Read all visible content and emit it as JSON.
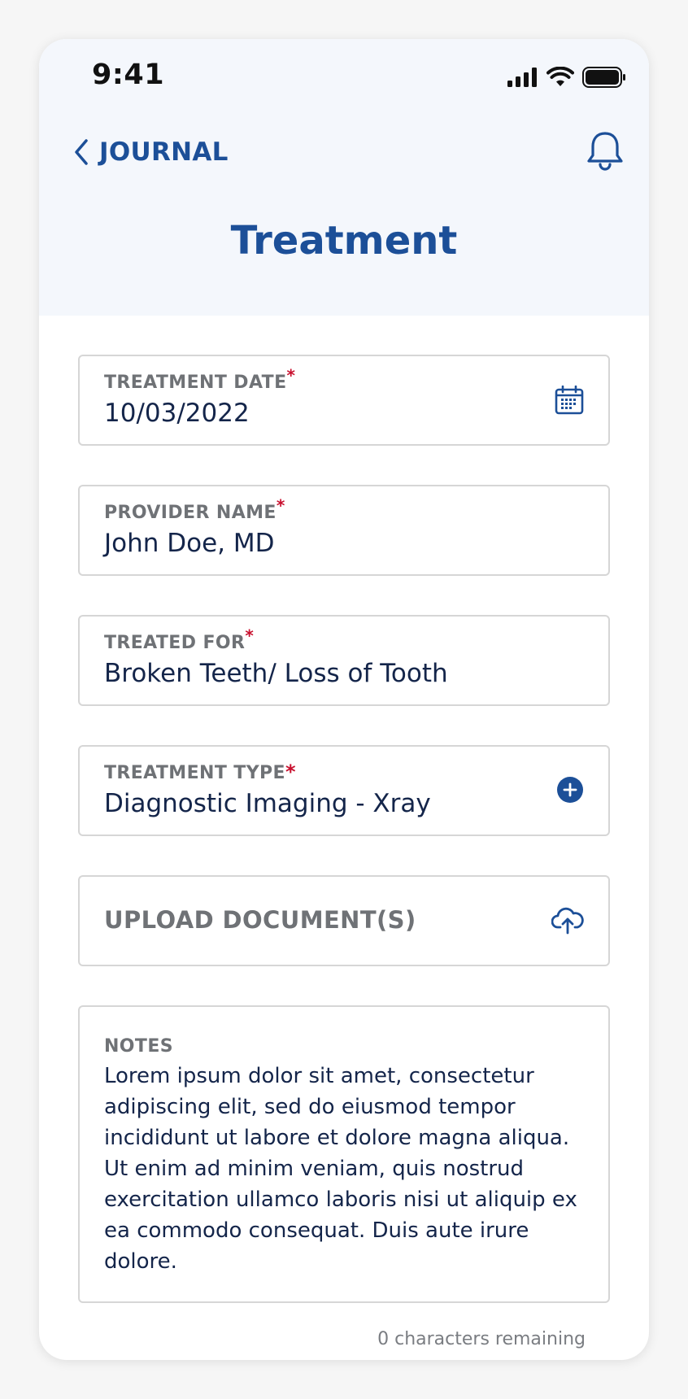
{
  "status_bar": {
    "time": "9:41"
  },
  "nav": {
    "back_label": "JOURNAL"
  },
  "page": {
    "title": "Treatment"
  },
  "form": {
    "treatment_date": {
      "label": "TREATMENT DATE",
      "required": "*",
      "value": "10/03/2022",
      "icon": "calendar-icon"
    },
    "provider_name": {
      "label": "PROVIDER NAME",
      "required": "*",
      "value": "John Doe, MD"
    },
    "treated_for": {
      "label": "TREATED FOR",
      "required": "*",
      "value": "Broken Teeth/ Loss of Tooth"
    },
    "treatment_type": {
      "label": "TREATMENT TYPE",
      "required": "*",
      "value": "Diagnostic Imaging - Xray",
      "icon": "plus-circle-icon"
    },
    "upload": {
      "label": "UPLOAD DOCUMENT(S)",
      "icon": "cloud-upload-icon"
    },
    "notes": {
      "label": "NOTES",
      "value": "Lorem ipsum dolor sit amet, consectetur adipiscing elit, sed do eiusmod tempor incididunt ut labore et dolore magna aliqua. Ut enim ad minim veniam, quis nostrud exercitation ullamco laboris nisi ut aliquip ex ea commodo consequat. Duis aute irure dolore.",
      "chars_remaining": "0 characters remaining"
    }
  },
  "colors": {
    "brand_blue": "#1c4f98",
    "required_red": "#c8102e",
    "label_gray": "#6f7276",
    "value_navy": "#14254a",
    "header_bg": "#f4f7fc"
  }
}
